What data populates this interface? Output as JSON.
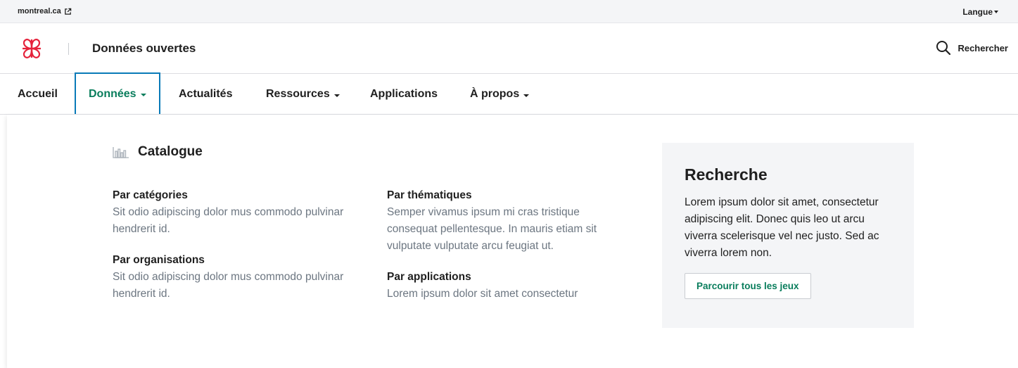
{
  "topbar": {
    "site_link": "montreal.ca",
    "language": "Langue"
  },
  "header": {
    "site_title": "Données ouvertes",
    "search_label": "Rechercher"
  },
  "nav": {
    "items": [
      {
        "label": "Accueil"
      },
      {
        "label": "Données"
      },
      {
        "label": "Actualités"
      },
      {
        "label": "Ressources"
      },
      {
        "label": "Applications"
      },
      {
        "label": "À propos"
      }
    ]
  },
  "dropdown": {
    "catalogue_title": "Catalogue",
    "links": [
      {
        "title": "Par catégories",
        "desc": "Sit odio adipiscing dolor mus commodo pulvinar hendrerit id."
      },
      {
        "title": "Par organisations",
        "desc": "Sit odio adipiscing dolor mus commodo pulvinar hendrerit id."
      },
      {
        "title": "Par thématiques",
        "desc": "Semper vivamus ipsum mi cras tristique consequat pellentesque. In mauris etiam sit vulputate vulputate arcu feugiat ut."
      },
      {
        "title": "Par applications",
        "desc": "Lorem ipsum dolor sit amet consectetur"
      }
    ],
    "panel": {
      "title": "Recherche",
      "text": "Lorem ipsum dolor sit amet, consectetur adipiscing elit. Donec quis leo ut arcu viverra scelerisque vel nec justo. Sed ac viverra lorem non.",
      "button": "Parcourir tous les jeux"
    }
  },
  "colors": {
    "accent_green": "#097d5c",
    "active_border": "#097ab8",
    "logo_red": "#e5223b"
  }
}
